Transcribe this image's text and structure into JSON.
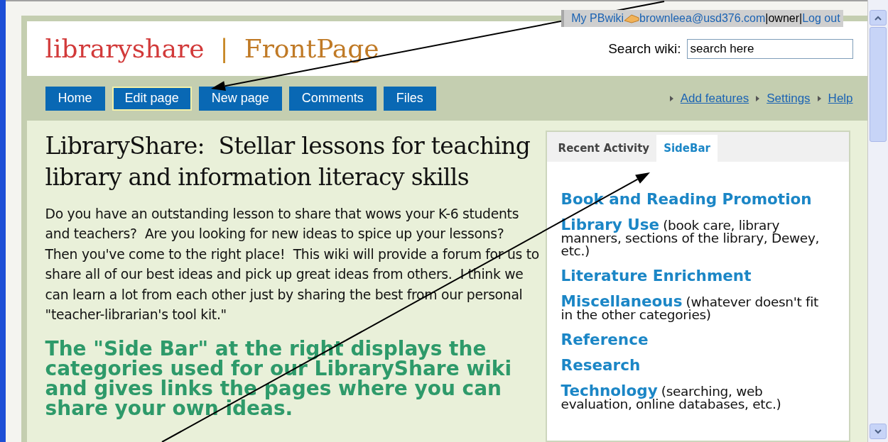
{
  "user_bar": {
    "my_wiki": "My PBwiki",
    "email": "brownleea@usd376.com",
    "separator": "|",
    "role": "owner",
    "logout": "Log out"
  },
  "header": {
    "wiki_name": "libraryshare",
    "separator": "|",
    "page_name": "FrontPage",
    "search": {
      "label": "Search wiki:",
      "value": "search here"
    }
  },
  "nav": {
    "buttons": [
      {
        "label": "Home",
        "selected": false
      },
      {
        "label": "Edit page",
        "selected": true
      },
      {
        "label": "New page",
        "selected": false
      },
      {
        "label": "Comments",
        "selected": false
      },
      {
        "label": "Files",
        "selected": false
      }
    ],
    "links": [
      "Add features",
      "Settings",
      "Help"
    ]
  },
  "article": {
    "heading": "LibraryShare:  Stellar lessons for teaching library and information literacy skills",
    "paragraph": "Do you have an outstanding lesson to share that wows your K-6 students and teachers?  Are you looking for new ideas to spice up your lessons?  Then you've come to the right place!  This wiki will provide a forum for us to share all of our best ideas and pick up great ideas from others.  I think we can learn a lot from each other just by sharing the best from our personal \"teacher-librarian's tool kit.\"",
    "callout": "The \"Side Bar\" at the right displays the categories used for our LibraryShare wiki and gives links the pages where you can share your own ideas."
  },
  "sidebar": {
    "tabs": [
      {
        "label": "Recent Activity",
        "selected": false
      },
      {
        "label": "SideBar",
        "selected": true
      }
    ],
    "items": [
      {
        "title": "Book and Reading Promotion"
      },
      {
        "title": "Library Use",
        "note": "(book care, library manners, sections of the library, Dewey, etc.)"
      },
      {
        "title": "Literature Enrichment"
      },
      {
        "title": "Miscellaneous",
        "note": "(whatever doesn't fit in the other categories)"
      },
      {
        "title": "Reference"
      },
      {
        "title": "Research"
      },
      {
        "title": "Technology",
        "note": "(searching, web evaluation, online databases, etc.)"
      }
    ]
  }
}
